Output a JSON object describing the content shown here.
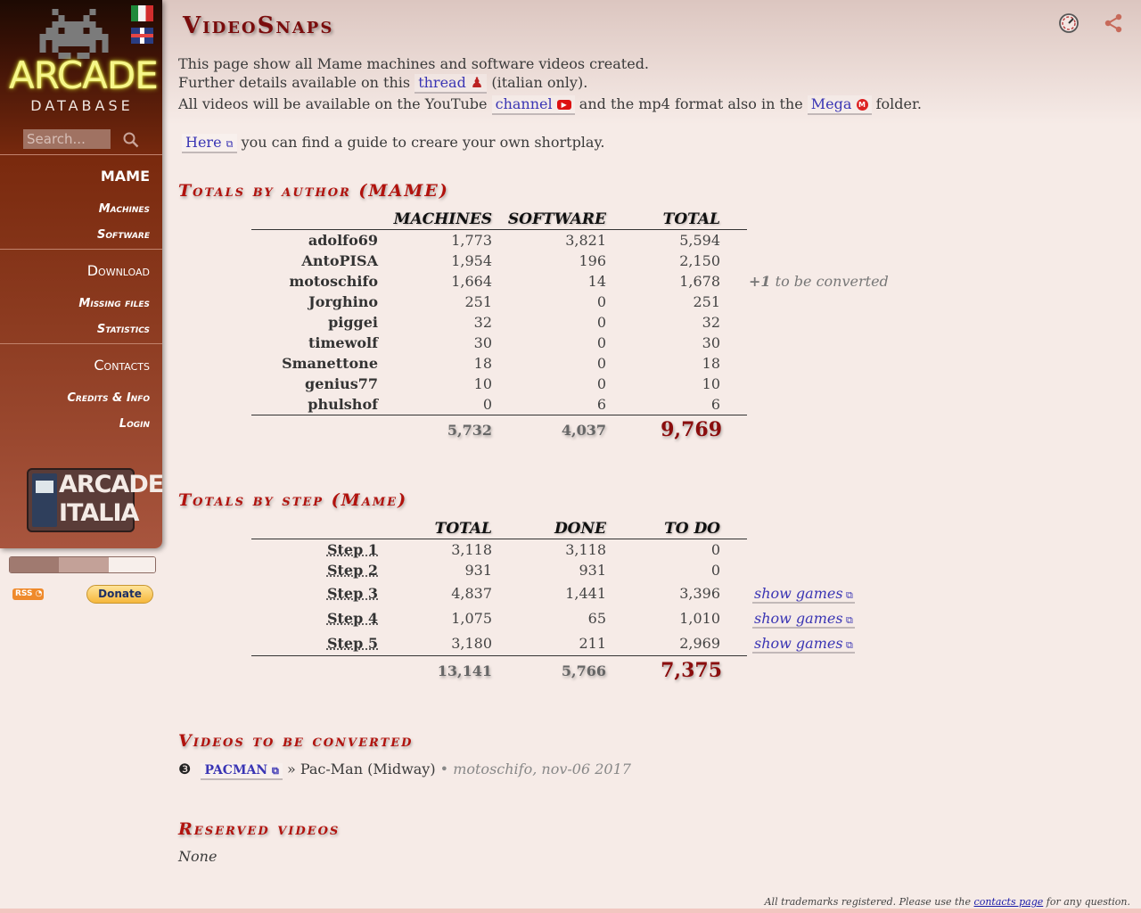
{
  "sidebar": {
    "logo_text": "ARCADE",
    "logo_sub": "DATABASE",
    "search_placeholder": "Search...",
    "nav": {
      "mame": "MAME",
      "machines": "Machines",
      "software": "Software",
      "download": "Download",
      "missing_files": "Missing files",
      "statistics": "Statistics",
      "contacts": "Contacts",
      "credits": "Credits & Info",
      "login": "Login"
    },
    "partner_logo": [
      "ARCADE",
      "ITALIA"
    ],
    "rss_label": "RSS",
    "donate_label": "Donate",
    "colors": {
      "bar": [
        "#a07a70",
        "#c3a198",
        "#f7efeb"
      ]
    }
  },
  "header": {
    "title": "VideoSnaps"
  },
  "intro": {
    "line1": "This page show all Mame machines and software videos created.",
    "line2_pre": "Further details available on this",
    "line2_link": "thread",
    "line2_post": "(italian only).",
    "line3_pre": "All videos will be available on the YouTube",
    "line3_link1": "channel",
    "line3_mid": "and the mp4 format also in the",
    "line3_link2": "Mega",
    "line3_post": "folder.",
    "line4_link": "Here",
    "line4_post": "you can find a guide to creare your own shortplay."
  },
  "authors": {
    "title": "Totals by author (MAME)",
    "headers": [
      "MACHINES",
      "SOFTWARE",
      "TOTAL"
    ],
    "rows": [
      {
        "name": "adolfo69",
        "machines": "1,773",
        "software": "3,821",
        "total": "5,594",
        "note": ""
      },
      {
        "name": "AntoPISA",
        "machines": "1,954",
        "software": "196",
        "total": "2,150",
        "note": ""
      },
      {
        "name": "motoschifo",
        "machines": "1,664",
        "software": "14",
        "total": "1,678",
        "note_count": "+1",
        "note": "to be converted"
      },
      {
        "name": "Jorghino",
        "machines": "251",
        "software": "0",
        "total": "251",
        "note": ""
      },
      {
        "name": "piggei",
        "machines": "32",
        "software": "0",
        "total": "32",
        "note": ""
      },
      {
        "name": "timewolf",
        "machines": "30",
        "software": "0",
        "total": "30",
        "note": ""
      },
      {
        "name": "Smanettone",
        "machines": "18",
        "software": "0",
        "total": "18",
        "note": ""
      },
      {
        "name": "genius77",
        "machines": "10",
        "software": "0",
        "total": "10",
        "note": ""
      },
      {
        "name": "phulshof",
        "machines": "0",
        "software": "6",
        "total": "6",
        "note": ""
      }
    ],
    "totals": {
      "machines": "5,732",
      "software": "4,037",
      "total": "9,769"
    }
  },
  "steps": {
    "title": "Totals by step (Mame)",
    "headers": [
      "TOTAL",
      "DONE",
      "TO DO"
    ],
    "rows": [
      {
        "name": "Step 1",
        "total": "3,118",
        "done": "3,118",
        "todo": "0",
        "link": ""
      },
      {
        "name": "Step 2",
        "total": "931",
        "done": "931",
        "todo": "0",
        "link": ""
      },
      {
        "name": "Step 3",
        "total": "4,837",
        "done": "1,441",
        "todo": "3,396",
        "link": "show games"
      },
      {
        "name": "Step 4",
        "total": "1,075",
        "done": "65",
        "todo": "1,010",
        "link": "show games"
      },
      {
        "name": "Step 5",
        "total": "3,180",
        "done": "211",
        "todo": "2,969",
        "link": "show games"
      }
    ],
    "totals": {
      "total": "13,141",
      "done": "5,766",
      "todo": "7,375"
    }
  },
  "convert": {
    "title": "Videos to be converted",
    "bullet": "❸",
    "game_link": "PACMAN",
    "game_name": "» Pac-Man (Midway)",
    "meta": "• motoschifo, nov-06 2017"
  },
  "reserved": {
    "title": "Reserved videos",
    "value": "None"
  },
  "footer": {
    "pre": "All trademarks registered. Please use the",
    "link": "contacts page",
    "post": "for any question."
  }
}
